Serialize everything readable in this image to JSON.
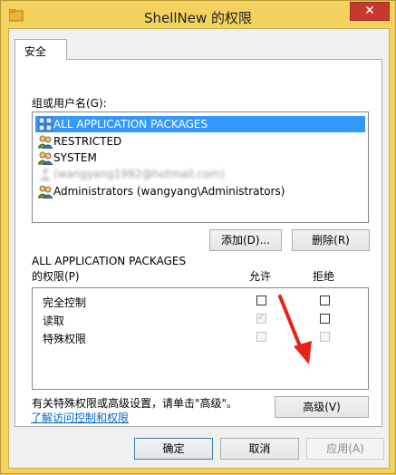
{
  "window": {
    "title": "ShellNew 的权限",
    "close_glyph": "✕"
  },
  "tabs": [
    {
      "label": "安全"
    }
  ],
  "security": {
    "groups_label": "组或用户名(G):",
    "principals": [
      {
        "name": "ALL APPLICATION PACKAGES",
        "icon": "app-packages-icon",
        "selected": true
      },
      {
        "name": "RESTRICTED",
        "icon": "users-group-icon",
        "selected": false
      },
      {
        "name": "SYSTEM",
        "icon": "users-group-icon",
        "selected": false
      },
      {
        "name": "(wangyang1992@hotmail.com)",
        "icon": "user-icon",
        "selected": false,
        "obscured": true
      },
      {
        "name": "Administrators (wangyang\\Administrators)",
        "icon": "users-group-icon",
        "selected": false
      }
    ],
    "add_button": "添加(D)...",
    "remove_button": "删除(R)",
    "perm_for_line1": "ALL APPLICATION PACKAGES",
    "perm_for_line2": "的权限(P)",
    "allow_header": "允许",
    "deny_header": "拒绝",
    "permissions": [
      {
        "name": "完全控制",
        "allow": false,
        "deny": false,
        "disabled": false
      },
      {
        "name": "读取",
        "allow": true,
        "deny": false,
        "disabled": true
      },
      {
        "name": "特殊权限",
        "allow": false,
        "deny": false,
        "disabled": true
      }
    ],
    "advanced_hint": "有关特殊权限或高级设置，请单击\"高级\"。",
    "advanced_button": "高级(V)",
    "learn_link": "了解访问控制和权限"
  },
  "footer": {
    "ok": "确定",
    "cancel": "取消",
    "apply": "应用(A)"
  },
  "colors": {
    "window_frame": "#f4d25f",
    "selection": "#3399ff",
    "close_button": "#c7392f",
    "annotation_arrow": "#e8211a",
    "link": "#0066cc"
  }
}
